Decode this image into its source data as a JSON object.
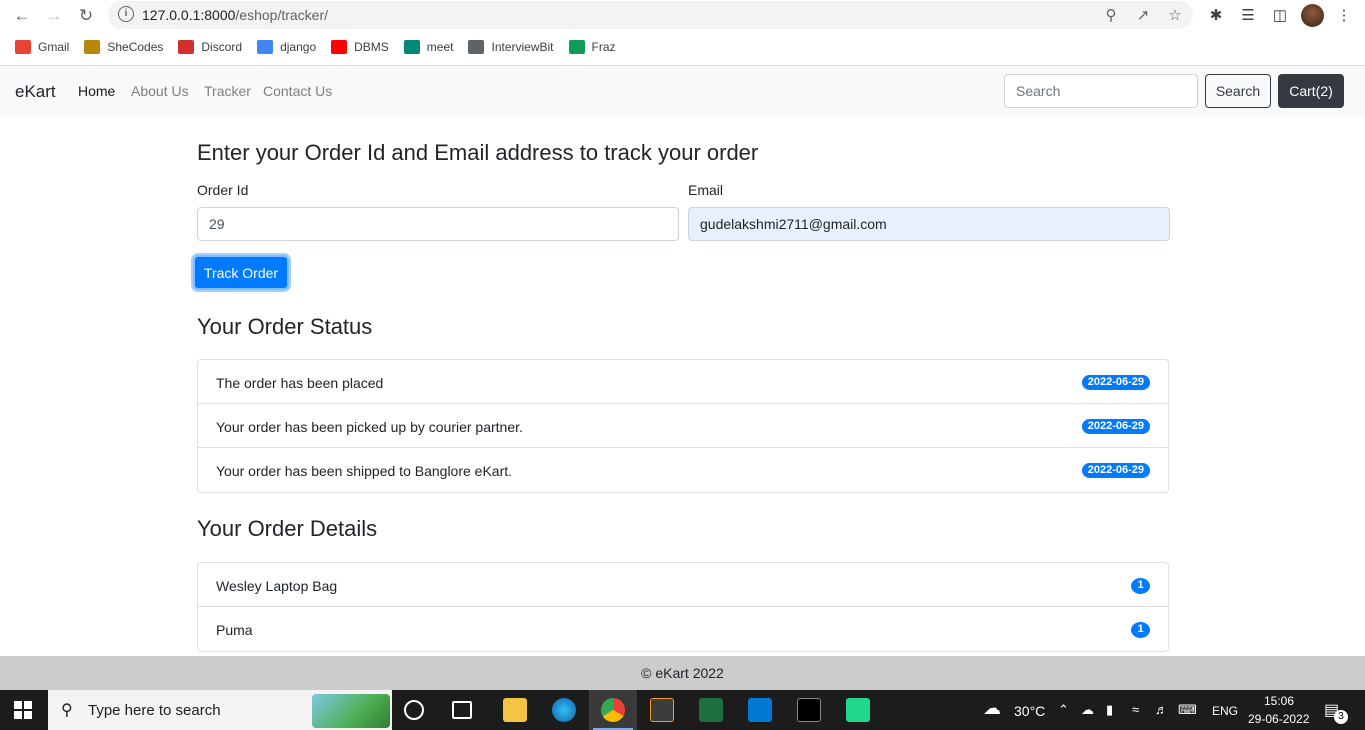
{
  "browser": {
    "url_host": "127.0.0.1:8000",
    "url_path": "/eshop/tracker/",
    "bookmarks": [
      {
        "label": "Gmail",
        "color": "#ea4335"
      },
      {
        "label": "SheCodes",
        "color": "#b8860b"
      },
      {
        "label": "Discord",
        "color": "#d32f2f"
      },
      {
        "label": "django",
        "color": "#4285f4"
      },
      {
        "label": "DBMS",
        "color": "#ff0000"
      },
      {
        "label": "meet",
        "color": "#00897b"
      },
      {
        "label": "InterviewBit",
        "color": "#5f6368"
      },
      {
        "label": "Fraz",
        "color": "#0f9d58"
      }
    ]
  },
  "nav": {
    "brand": "eKart",
    "links": [
      "Home",
      "About Us",
      "Tracker",
      "Contact Us"
    ],
    "search_placeholder": "Search",
    "search_button": "Search",
    "cart_button": "Cart(2)"
  },
  "tracker": {
    "heading": "Enter your Order Id and Email address to track your order",
    "order_label": "Order Id",
    "order_value": "29",
    "email_label": "Email",
    "email_value": "gudelakshmi2711@gmail.com",
    "track_button": "Track Order"
  },
  "status": {
    "heading": "Your Order Status",
    "items": [
      {
        "text": "The order has been placed",
        "date": "2022-06-29"
      },
      {
        "text": "Your order has been picked up by courier partner.",
        "date": "2022-06-29"
      },
      {
        "text": "Your order has been shipped to Banglore eKart.",
        "date": "2022-06-29"
      }
    ]
  },
  "details": {
    "heading": "Your Order Details",
    "items": [
      {
        "name": "Wesley Laptop Bag",
        "qty": "1"
      },
      {
        "name": "Puma",
        "qty": "1"
      }
    ]
  },
  "footer": {
    "text": "© eKart 2022"
  },
  "taskbar": {
    "search_placeholder": "Type here to search",
    "weather": "30°C",
    "lang": "ENG",
    "time": "15:06",
    "date": "29-06-2022",
    "notifications": "3"
  },
  "colors": {
    "primary": "#007bff",
    "dark": "#343a40",
    "navbg": "#f8f9fa"
  }
}
